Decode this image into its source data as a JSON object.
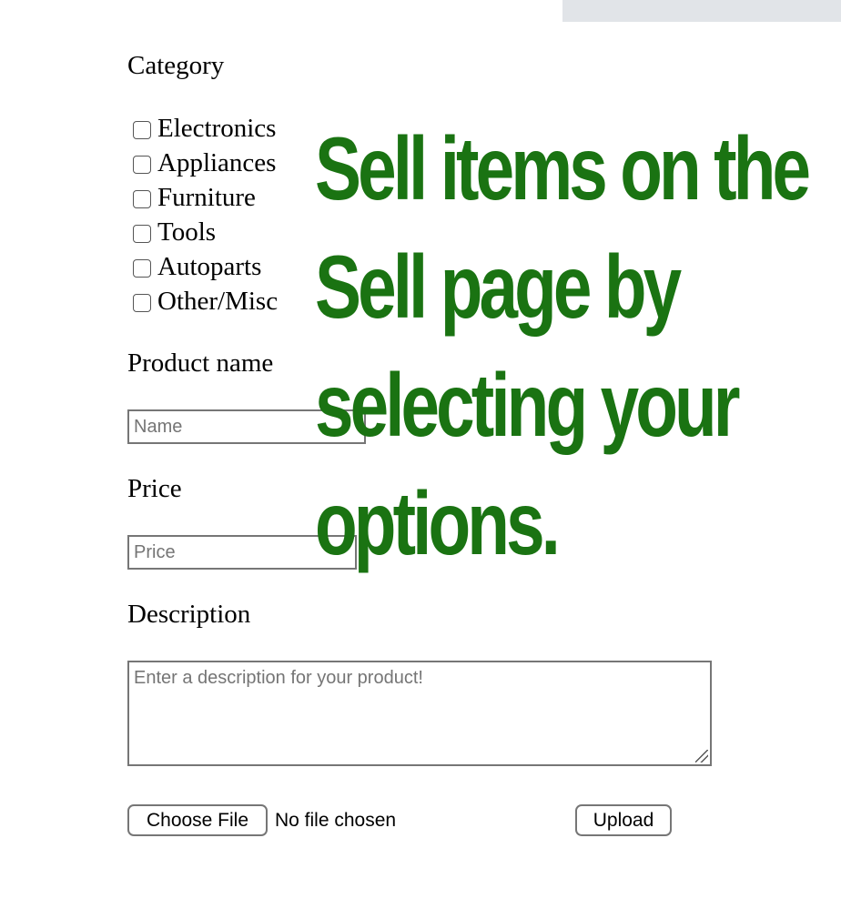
{
  "form": {
    "category_label": "Category",
    "categories": [
      "Electronics",
      "Appliances",
      "Furniture",
      "Tools",
      "Autoparts",
      "Other/Misc"
    ],
    "product_name_label": "Product name",
    "product_name_placeholder": "Name",
    "price_label": "Price",
    "price_placeholder": "Price",
    "description_label": "Description",
    "description_placeholder": "Enter a description for your product!",
    "choose_file_label": "Choose File",
    "file_status": "No file chosen",
    "upload_label": "Upload"
  },
  "overlay": {
    "lines": [
      "Sell items on the",
      "Sell page by",
      "selecting your",
      "options."
    ],
    "color": "#1a7312"
  }
}
